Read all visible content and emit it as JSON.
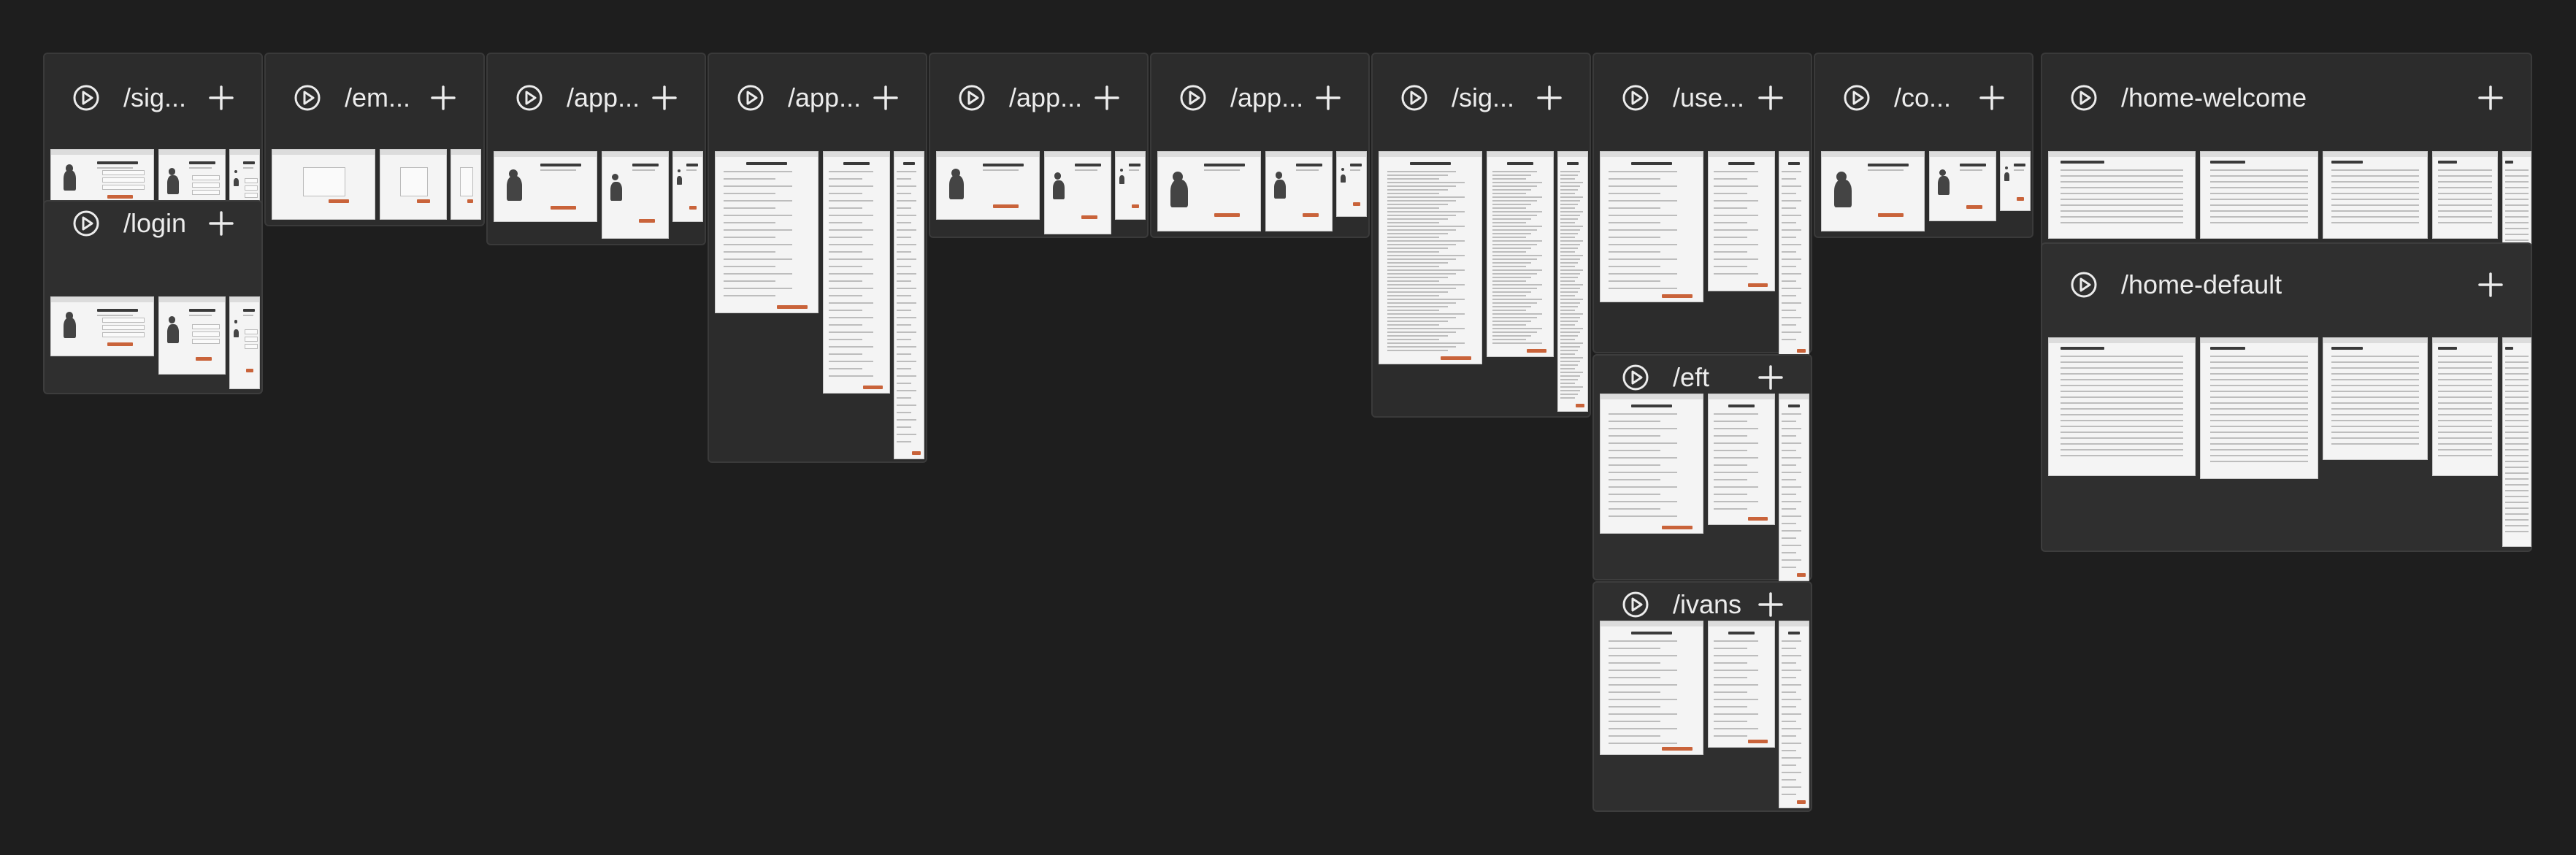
{
  "sections": [
    {
      "id": "signup",
      "title": "/sig...",
      "kind": "illustrated-form"
    },
    {
      "id": "login",
      "title": "/login",
      "kind": "illustrated-form"
    },
    {
      "id": "email",
      "title": "/em...",
      "kind": "dialog"
    },
    {
      "id": "app1",
      "title": "/app...",
      "kind": "illustration"
    },
    {
      "id": "app2",
      "title": "/app...",
      "kind": "form"
    },
    {
      "id": "app3",
      "title": "/app...",
      "kind": "illustration"
    },
    {
      "id": "app4",
      "title": "/app...",
      "kind": "illustration"
    },
    {
      "id": "sig2",
      "title": "/sig...",
      "kind": "document"
    },
    {
      "id": "user",
      "title": "/use...",
      "kind": "form"
    },
    {
      "id": "eft",
      "title": "/eft",
      "kind": "form"
    },
    {
      "id": "ivans",
      "title": "/ivans",
      "kind": "form"
    },
    {
      "id": "co",
      "title": "/co...",
      "kind": "illustration"
    },
    {
      "id": "home-welcome",
      "title": "/home-welcome",
      "kind": "table"
    },
    {
      "id": "home-default",
      "title": "/home-default",
      "kind": "table"
    }
  ],
  "icons": {
    "play": "play-icon",
    "add": "plus-icon"
  },
  "colors": {
    "canvas": "#1e1e1e",
    "section": "#2c2c2c",
    "accent": "#c9633a",
    "text": "#ececec"
  }
}
